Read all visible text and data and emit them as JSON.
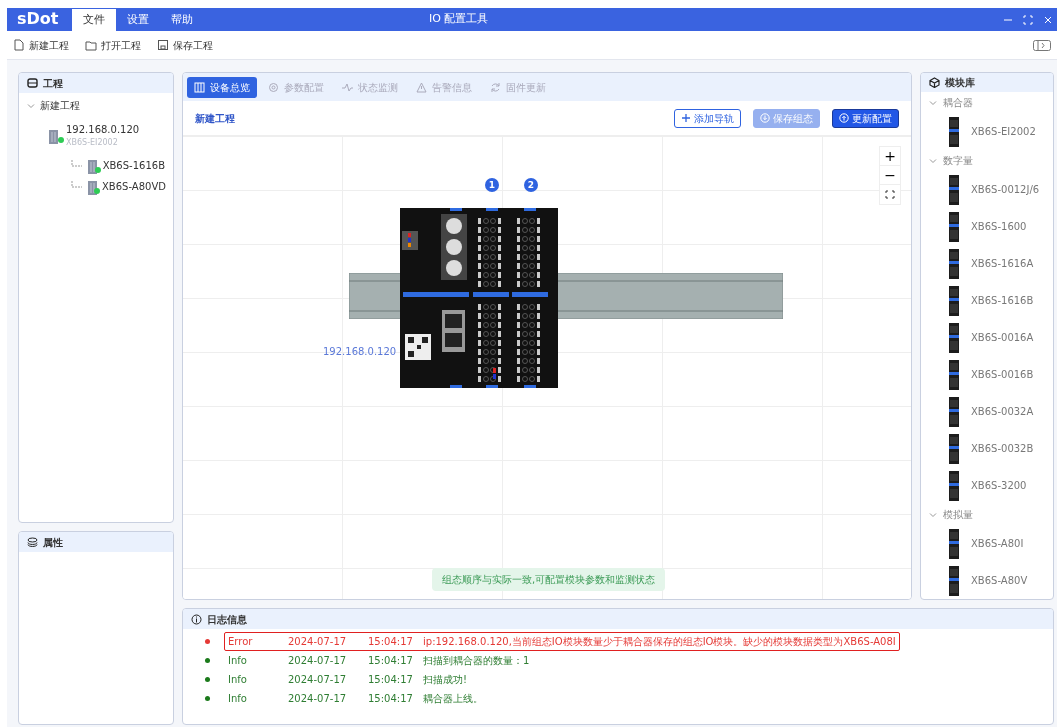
{
  "window": {
    "logo": "sDot",
    "title": "IO 配置工具"
  },
  "menu": [
    {
      "label": "文件",
      "selected": true
    },
    {
      "label": "设置",
      "selected": false
    },
    {
      "label": "帮助",
      "selected": false
    }
  ],
  "toolbar": [
    {
      "kind": "new",
      "label": "新建工程"
    },
    {
      "kind": "open",
      "label": "打开工程"
    },
    {
      "kind": "save",
      "label": "保存工程"
    }
  ],
  "project_panel": {
    "title": "工程",
    "tree": [
      {
        "label": "新建工程",
        "expanded": true,
        "children": [
          {
            "label": "192.168.0.120",
            "sublabel": "XB6S-EI2002",
            "online": true,
            "children": [
              {
                "label": "XB6S-1616B",
                "online": true
              },
              {
                "label": "XB6S-A80VD",
                "online": true
              }
            ]
          }
        ]
      }
    ]
  },
  "properties_panel": {
    "title": "属性"
  },
  "tabs": [
    {
      "kind": "overview",
      "label": "设备总览",
      "selected": true,
      "disabled": false
    },
    {
      "kind": "params",
      "label": "参数配置",
      "selected": false,
      "disabled": true
    },
    {
      "kind": "monitor",
      "label": "状态监测",
      "selected": false,
      "disabled": true
    },
    {
      "kind": "alarm",
      "label": "告警信息",
      "selected": false,
      "disabled": true
    },
    {
      "kind": "firmware",
      "label": "固件更新",
      "selected": false,
      "disabled": true
    }
  ],
  "workspace": {
    "title": "新建工程",
    "buttons": [
      {
        "kind": "outline",
        "label": "添加导轨",
        "disabled": false
      },
      {
        "kind": "save",
        "label": "保存组态",
        "disabled": true
      },
      {
        "kind": "update",
        "label": "更新配置",
        "disabled": false
      }
    ],
    "zoom_controls": [
      "+",
      "−"
    ],
    "slots": [
      "1",
      "2"
    ],
    "ip_label": "192.168.0.120",
    "status_message": "组态顺序与实际一致,可配置模块参数和监测状态"
  },
  "module_library": {
    "title": "模块库",
    "groups": [
      {
        "label": "耦合器",
        "expanded": true,
        "items": [
          "XB6S-EI2002"
        ]
      },
      {
        "label": "数字量",
        "expanded": true,
        "items": [
          "XB6S-0012J/6",
          "XB6S-1600",
          "XB6S-1616A",
          "XB6S-1616B",
          "XB6S-0016A",
          "XB6S-0016B",
          "XB6S-0032A",
          "XB6S-0032B",
          "XB6S-3200"
        ]
      },
      {
        "label": "模拟量",
        "expanded": true,
        "items": [
          "XB6S-A80I",
          "XB6S-A80V"
        ]
      }
    ]
  },
  "log": {
    "title": "日志信息",
    "entries": [
      {
        "kind": "error",
        "type": "Error",
        "date": "2024-07-17",
        "time": "15:04:17",
        "message": "ip:192.168.0.120,当前组态IO模块数量少于耦合器保存的组态IO模块。缺少的模块数据类型为XB6S-A08I",
        "highlighted": true
      },
      {
        "kind": "info",
        "type": "Info",
        "date": "2024-07-17",
        "time": "15:04:17",
        "message": "扫描到耦合器的数量：1",
        "highlighted": false
      },
      {
        "kind": "info",
        "type": "Info",
        "date": "2024-07-17",
        "time": "15:04:17",
        "message": "扫描成功!",
        "highlighted": false
      },
      {
        "kind": "info",
        "type": "Info",
        "date": "2024-07-17",
        "time": "15:04:17",
        "message": "耦合器上线。",
        "highlighted": false
      }
    ]
  }
}
